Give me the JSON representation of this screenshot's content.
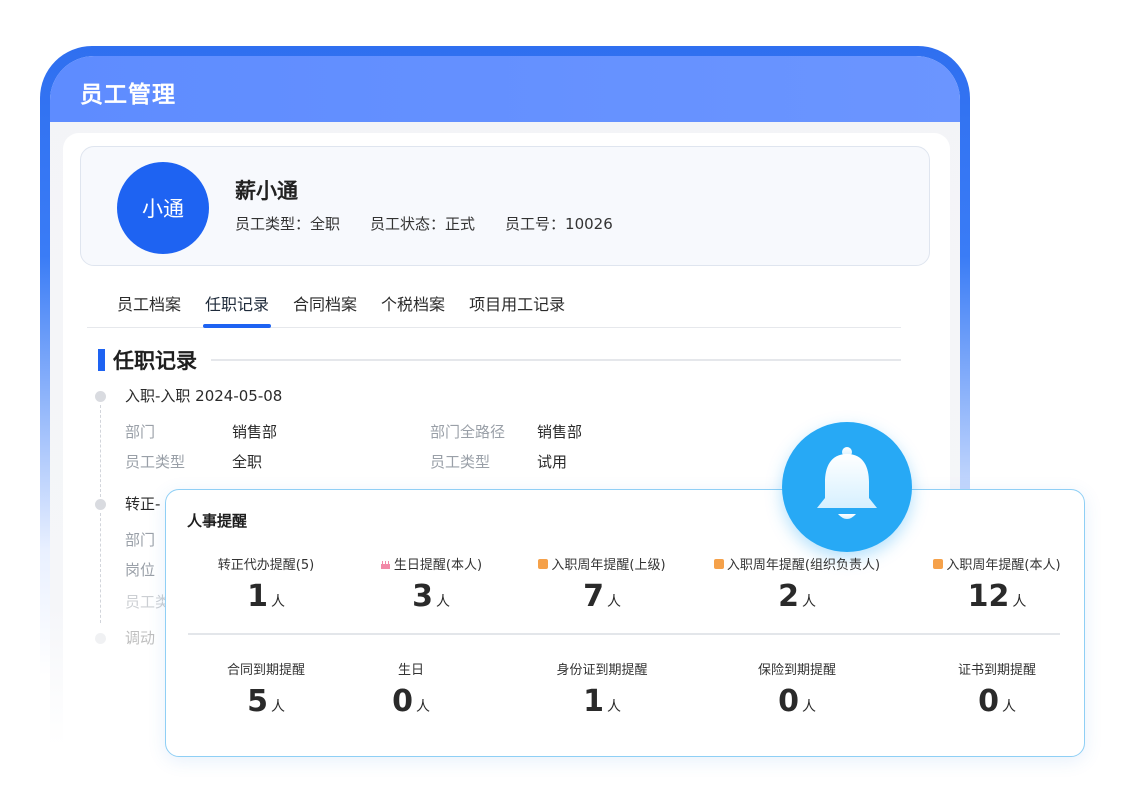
{
  "app": {
    "title": "员工管理"
  },
  "employee": {
    "avatar_text": "小通",
    "name": "薪小通",
    "type_text": "员工类型：全职",
    "status_text": "员工状态：正式",
    "number_text": "员工号：10026"
  },
  "tabs": [
    {
      "label": "员工档案"
    },
    {
      "label": "任职记录",
      "active": true
    },
    {
      "label": "合同档案"
    },
    {
      "label": "个税档案"
    },
    {
      "label": "项目用工记录"
    }
  ],
  "section": {
    "title": "任职记录"
  },
  "timeline": [
    {
      "head": "入职-入职 2024-05-08",
      "rows": [
        [
          {
            "label": "部门",
            "value": "销售部"
          },
          {
            "label": "部门全路径",
            "value": "销售部"
          }
        ],
        [
          {
            "label": "员工类型",
            "value": "全职"
          },
          {
            "label": "员工类型",
            "value": "试用"
          }
        ]
      ]
    },
    {
      "head": "转正-",
      "rows": [
        [
          {
            "label": "部门",
            "value": ""
          }
        ],
        [
          {
            "label": "岗位",
            "value": ""
          }
        ],
        [
          {
            "label": "员工类",
            "value": ""
          }
        ]
      ]
    },
    {
      "head": "调动",
      "rows": []
    }
  ],
  "reminder": {
    "title": "人事提醒",
    "unit": "人",
    "row1": [
      {
        "label": "转正代办提醒(5)",
        "value": "1",
        "icon": ""
      },
      {
        "label": "生日提醒(本人)",
        "value": "3",
        "icon": "cake-icon"
      },
      {
        "label": "入职周年提醒(上级)",
        "value": "7",
        "icon": "badge-icon"
      },
      {
        "label": "入职周年提醒(组织负责人)",
        "value": "2",
        "icon": "badge-icon"
      },
      {
        "label": "入职周年提醒(本人)",
        "value": "12",
        "icon": "badge-icon"
      }
    ],
    "row2": [
      {
        "label": "合同到期提醒",
        "value": "5"
      },
      {
        "label": "生日",
        "value": "0"
      },
      {
        "label": "身份证到期提醒",
        "value": "1"
      },
      {
        "label": "保险到期提醒",
        "value": "0"
      },
      {
        "label": "证书到期提醒",
        "value": "0"
      }
    ]
  },
  "colors": {
    "accent": "#1e63f2",
    "title_bar": "#6b95ff",
    "bell": "#27a9f5",
    "cake_icon": "#f28aa8",
    "badge_icon": "#f5a14a"
  }
}
